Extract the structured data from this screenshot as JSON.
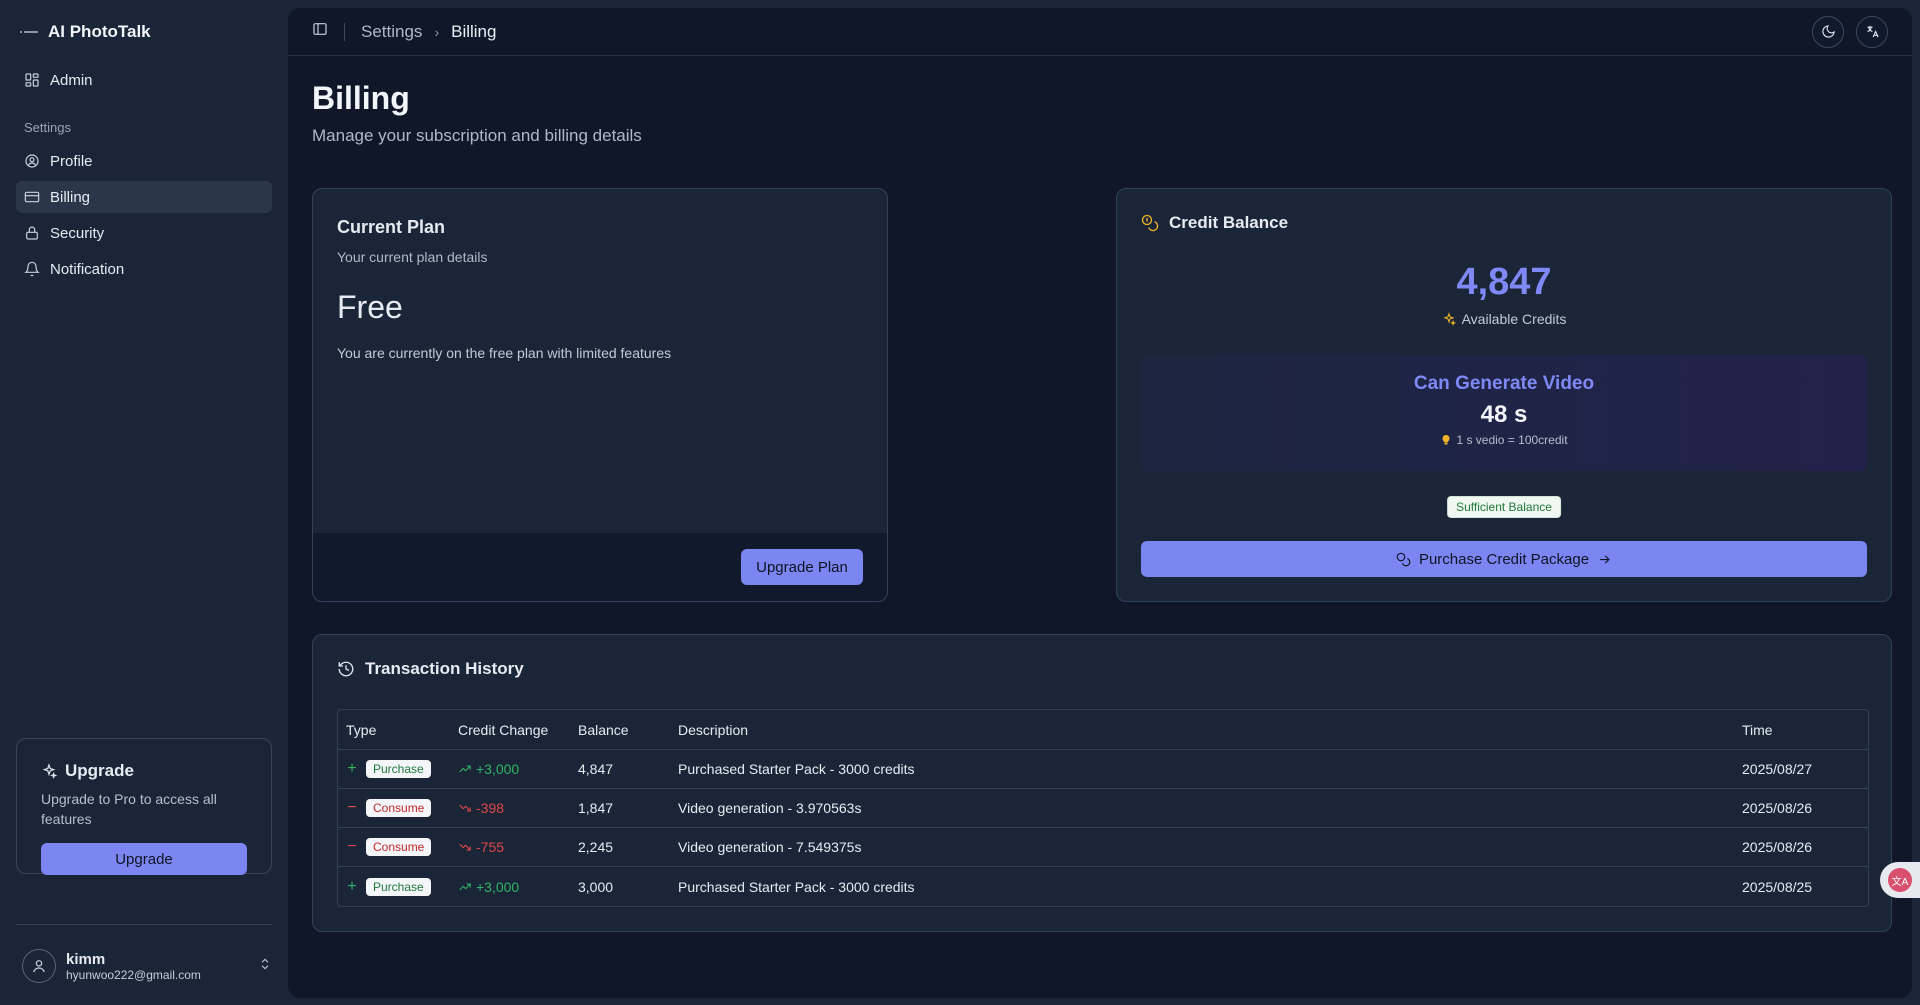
{
  "brand": {
    "name": "AI PhotoTalk"
  },
  "sidebar": {
    "admin_label": "Admin",
    "group_label": "Settings",
    "items": [
      {
        "label": "Profile"
      },
      {
        "label": "Billing"
      },
      {
        "label": "Security"
      },
      {
        "label": "Notification"
      }
    ],
    "upgrade": {
      "title": "Upgrade",
      "desc": "Upgrade to Pro to access all features",
      "button": "Upgrade"
    },
    "user": {
      "name": "kimm",
      "email": "hyunwoo222@gmail.com"
    }
  },
  "breadcrumb": {
    "parent": "Settings",
    "current": "Billing"
  },
  "page": {
    "title": "Billing",
    "subtitle": "Manage your subscription and billing details"
  },
  "plan": {
    "title": "Current Plan",
    "subtitle": "Your current plan details",
    "name": "Free",
    "desc": "You are currently on the free plan with limited features",
    "button": "Upgrade Plan"
  },
  "credit": {
    "title": "Credit Balance",
    "amount": "4,847",
    "amount_label": "Available Credits",
    "gen_label": "Can Generate Video",
    "gen_value": "48 s",
    "rate": "1 s vedio = 100credit",
    "status": "Sufficient Balance",
    "button": "Purchase Credit Package"
  },
  "transactions": {
    "title": "Transaction History",
    "columns": [
      "Type",
      "Credit Change",
      "Balance",
      "Description",
      "Time"
    ],
    "rows": [
      {
        "type": "Purchase",
        "change": "+3,000",
        "balance": "4,847",
        "desc": "Purchased Starter Pack - 3000 credits",
        "time": "2025/08/27"
      },
      {
        "type": "Consume",
        "change": "-398",
        "balance": "1,847",
        "desc": "Video generation - 3.970563s",
        "time": "2025/08/26"
      },
      {
        "type": "Consume",
        "change": "-755",
        "balance": "2,245",
        "desc": "Video generation - 7.549375s",
        "time": "2025/08/26"
      },
      {
        "type": "Purchase",
        "change": "+3,000",
        "balance": "3,000",
        "desc": "Purchased Starter Pack - 3000 credits",
        "time": "2025/08/25"
      }
    ]
  },
  "colors": {
    "accent": "#7b86f2",
    "positive": "#30b463",
    "negative": "#e04848",
    "gold": "#f0b429"
  }
}
